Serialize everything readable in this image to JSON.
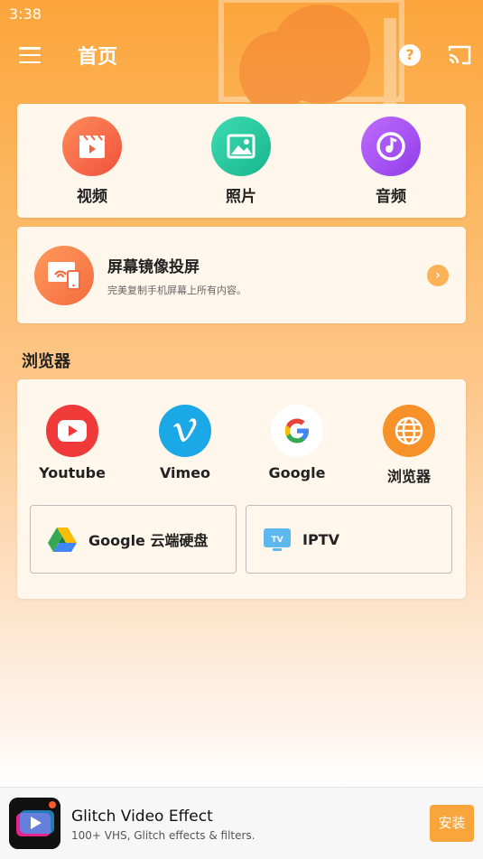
{
  "status": {
    "time": "3:38"
  },
  "header": {
    "title": "首页",
    "help_glyph": "?"
  },
  "media": [
    {
      "label": "视频",
      "icon": "video-icon",
      "color": "#f3643f"
    },
    {
      "label": "照片",
      "icon": "photo-icon",
      "color": "#1ec9a0"
    },
    {
      "label": "音频",
      "icon": "audio-icon",
      "color": "#a24ff0"
    }
  ],
  "mirror": {
    "title": "屏幕镜像投屏",
    "subtitle": "完美复制手机屏幕上所有内容。",
    "arrow_glyph": "›"
  },
  "browser_section": {
    "title": "浏览器",
    "items": [
      {
        "label": "Youtube",
        "icon": "youtube-icon"
      },
      {
        "label": "Vimeo",
        "icon": "vimeo-icon"
      },
      {
        "label": "Google",
        "icon": "google-icon"
      },
      {
        "label": "浏览器",
        "icon": "globe-icon"
      }
    ],
    "buttons": [
      {
        "label": "Google 云端硬盘",
        "icon": "google-drive-icon"
      },
      {
        "label": "IPTV",
        "icon": "tv-icon",
        "icon_text": "TV"
      }
    ]
  },
  "ad": {
    "title": "Glitch Video Effect",
    "subtitle": "100+ VHS, Glitch effects & filters.",
    "install_label": "安装"
  },
  "colors": {
    "accent": "#f8a53c",
    "card": "#fff6ec"
  }
}
